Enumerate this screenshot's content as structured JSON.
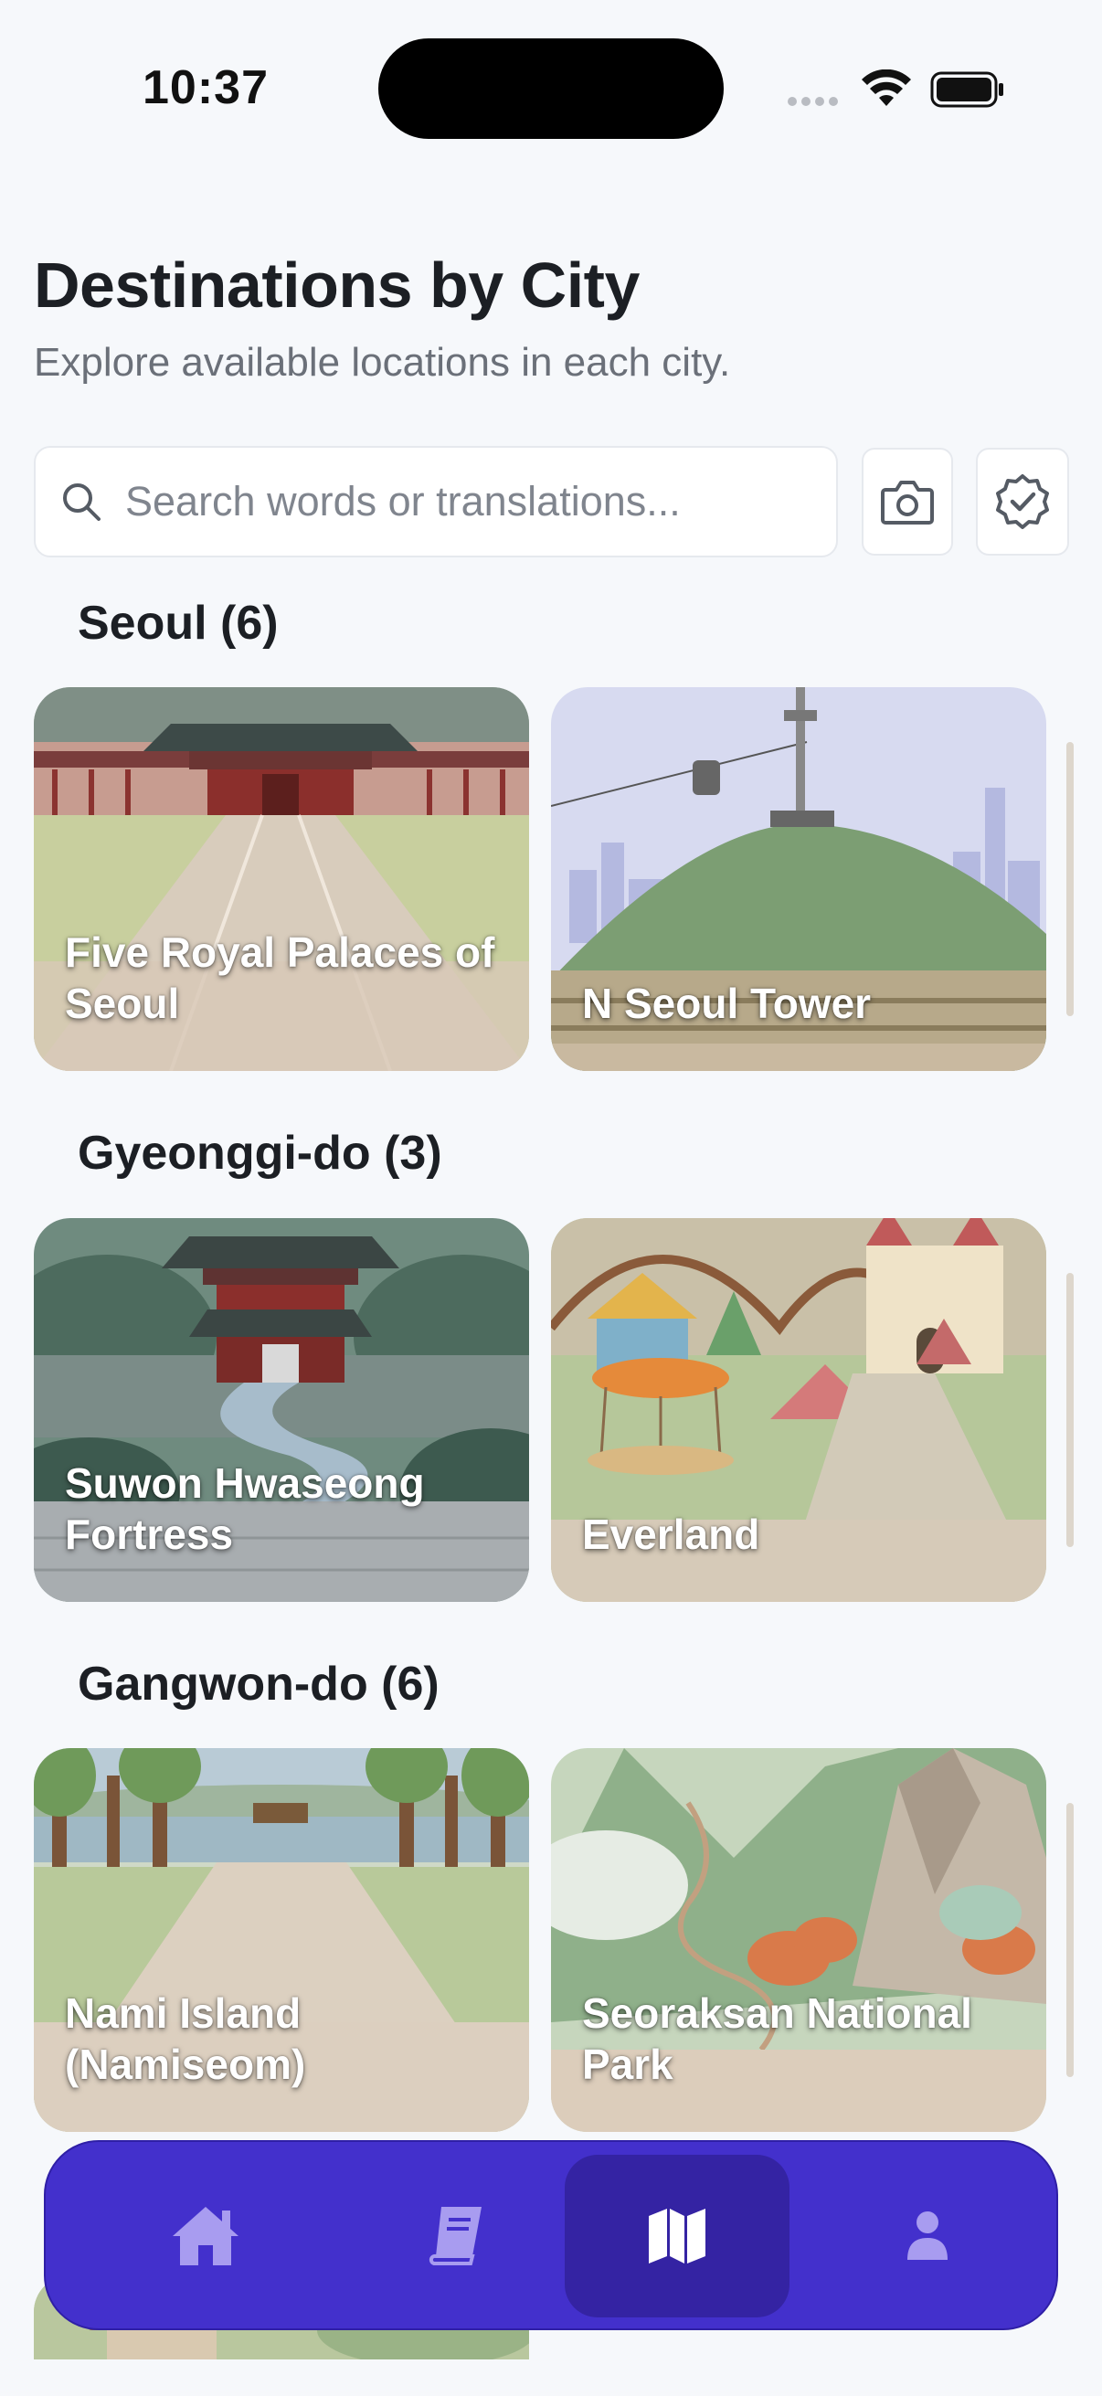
{
  "status_bar": {
    "time": "10:37"
  },
  "header": {
    "title": "Destinations by City",
    "subtitle": "Explore available locations in each city."
  },
  "search": {
    "placeholder": "Search words or translations..."
  },
  "toolbar_icons": [
    "camera-icon",
    "verified-badge-icon"
  ],
  "sections": [
    {
      "title": "Seoul (6)",
      "cards": [
        {
          "label": "Five Royal Palaces of Seoul"
        },
        {
          "label": "N Seoul Tower"
        }
      ]
    },
    {
      "title": "Gyeonggi-do (3)",
      "cards": [
        {
          "label": "Suwon Hwaseong Fortress"
        },
        {
          "label": "Everland"
        }
      ]
    },
    {
      "title": "Gangwon-do (6)",
      "cards": [
        {
          "label": "Nami Island (Namiseom)"
        },
        {
          "label": "Seoraksan National Park"
        }
      ]
    }
  ],
  "bottom_nav": {
    "items": [
      {
        "icon": "home-icon",
        "active": false
      },
      {
        "icon": "book-icon",
        "active": false
      },
      {
        "icon": "map-icon",
        "active": true
      },
      {
        "icon": "user-icon",
        "active": false
      }
    ]
  },
  "colors": {
    "background": "#f6f8fb",
    "nav_bar": "#4330cc",
    "nav_active": "#3423a3",
    "nav_icon_inactive": "#a89cf0",
    "nav_icon_active": "#ffffff"
  }
}
